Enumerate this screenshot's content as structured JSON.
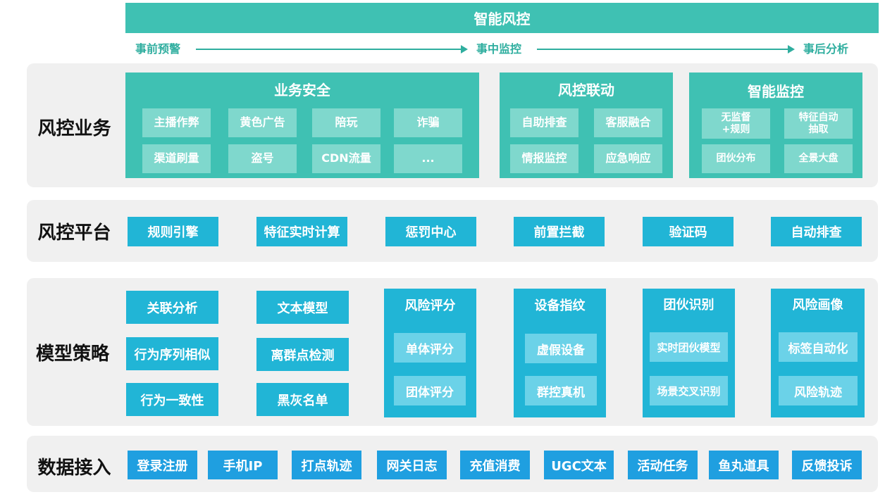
{
  "header": {
    "title": "智能风控",
    "phases": [
      "事前预警",
      "事中监控",
      "事后分析"
    ]
  },
  "rows": {
    "business": {
      "label": "风控业务",
      "groups": [
        {
          "title": "业务安全",
          "items": [
            "主播作弊",
            "黄色广告",
            "陪玩",
            "诈骗",
            "渠道刷量",
            "盗号",
            "CDN流量",
            "..."
          ]
        },
        {
          "title": "风控联动",
          "items": [
            "自助排查",
            "客服融合",
            "情报监控",
            "应急响应"
          ]
        },
        {
          "title": "智能监控",
          "items": [
            "无监督\n+规则",
            "特征自动\n抽取",
            "团伙分布",
            "全景大盘"
          ]
        }
      ]
    },
    "platform": {
      "label": "风控平台",
      "items": [
        "规则引擎",
        "特征实时计算",
        "惩罚中心",
        "前置拦截",
        "验证码",
        "自动排查"
      ]
    },
    "model": {
      "label": "模型策略",
      "col1": [
        "关联分析",
        "行为序列相似",
        "行为一致性"
      ],
      "col2": [
        "文本模型",
        "离群点检测",
        "黑灰名单"
      ],
      "columns": [
        {
          "title": "风险评分",
          "items": [
            "单体评分",
            "团体评分"
          ]
        },
        {
          "title": "设备指纹",
          "items": [
            "虚假设备",
            "群控真机"
          ]
        },
        {
          "title": "团伙识别",
          "items": [
            "实时团伙模型",
            "场景交叉识别"
          ]
        },
        {
          "title": "风险画像",
          "items": [
            "标签自动化",
            "风险轨迹"
          ]
        }
      ]
    },
    "data": {
      "label": "数据接入",
      "items": [
        "登录注册",
        "手机IP",
        "打点轨迹",
        "网关日志",
        "充值消费",
        "UGC文本",
        "活动任务",
        "鱼丸道具",
        "反馈投诉"
      ]
    }
  },
  "colors": {
    "teal": "#3fc1b3",
    "teal_chip": "#7fd8cd",
    "cyan": "#21b5d6",
    "cyan_chip": "#6bd2e8",
    "blue": "#1f9fe0",
    "band": "#f0f0f0"
  }
}
